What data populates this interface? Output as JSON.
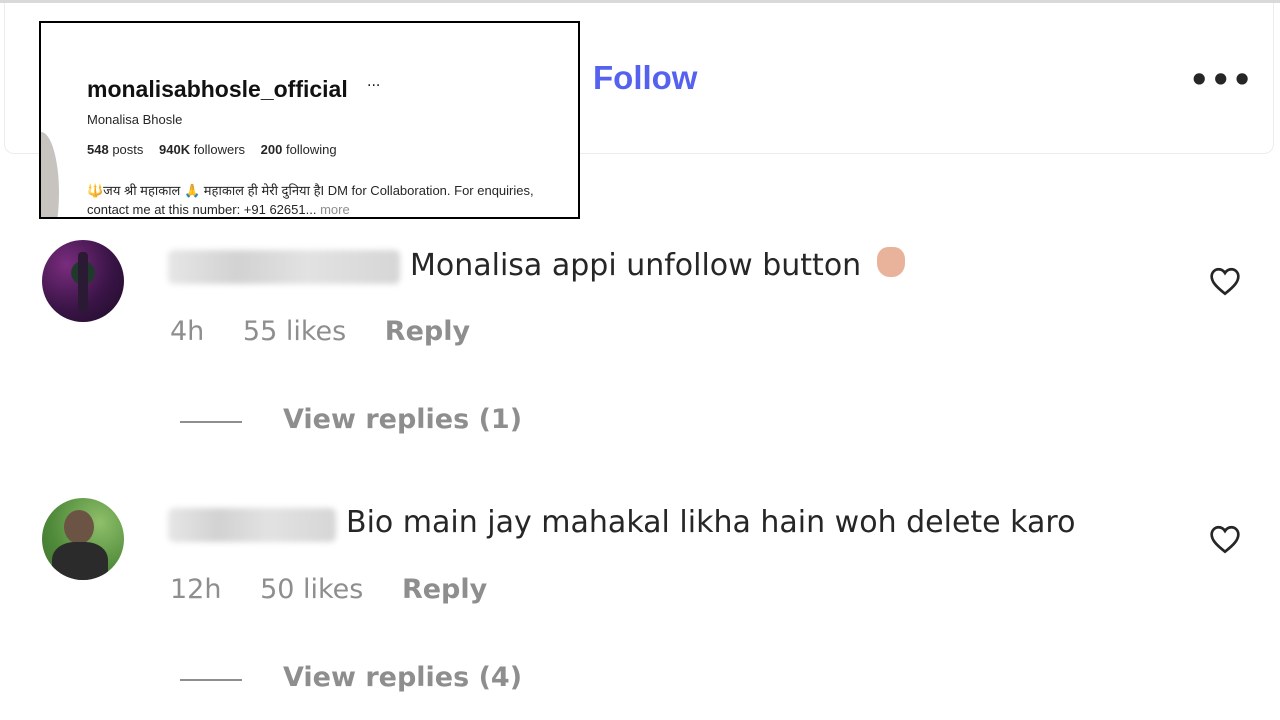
{
  "header": {
    "follow_label": "Follow",
    "more_options_label": "•••"
  },
  "profile_popup": {
    "username": "monalisabhosle_official",
    "ellipsis": "···",
    "full_name": "Monalisa Bhosle",
    "posts_count": "548",
    "posts_label": "posts",
    "followers_count": "940K",
    "followers_label": "followers",
    "following_count": "200",
    "following_label": "following",
    "bio": "🔱जय श्री महाकाल 🙏 महाकाल ही मेरी दुनिया हैI DM for Collaboration. For enquiries, contact me at this number: +91 62651...",
    "bio_more": "more"
  },
  "comments": [
    {
      "text": "Monalisa appi unfollow button",
      "time": "4h",
      "likes": "55 likes",
      "reply_label": "Reply",
      "view_replies": "View replies (1)"
    },
    {
      "text": "Bio main jay mahakal likha hain woh delete karo",
      "time": "12h",
      "likes": "50 likes",
      "reply_label": "Reply",
      "view_replies": "View replies (4)"
    }
  ],
  "icons": {
    "like": "heart-icon",
    "more": "more-options-icon",
    "emoji": "thumbs-up-emoji"
  }
}
